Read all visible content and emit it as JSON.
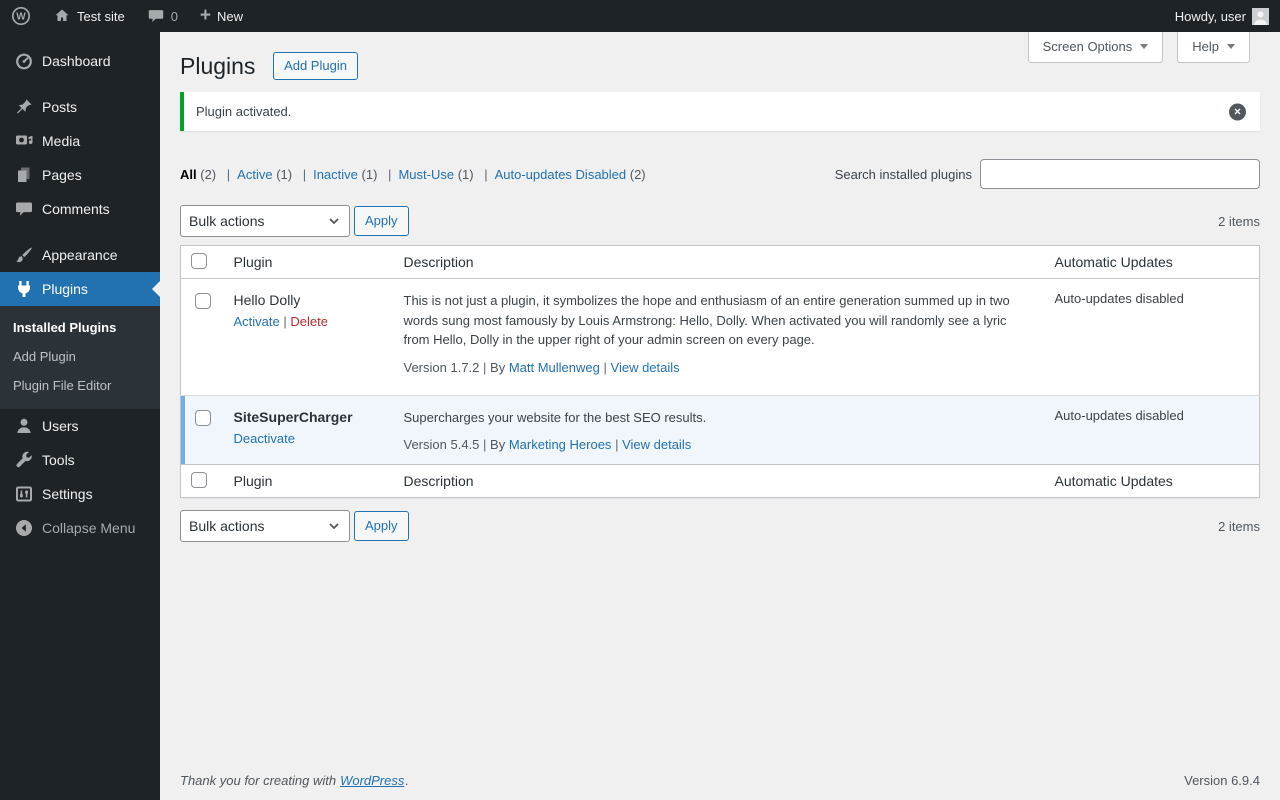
{
  "ui": {
    "separator": "|"
  },
  "admin_bar": {
    "site_name": "Test site",
    "comments_count": "0",
    "new_label": "New",
    "greeting": "Howdy, user"
  },
  "sidebar": {
    "items": [
      {
        "label": "Dashboard"
      },
      {
        "label": "Posts"
      },
      {
        "label": "Media"
      },
      {
        "label": "Pages"
      },
      {
        "label": "Comments"
      },
      {
        "label": "Appearance"
      },
      {
        "label": "Plugins"
      },
      {
        "label": "Users"
      },
      {
        "label": "Tools"
      },
      {
        "label": "Settings"
      },
      {
        "label": "Collapse Menu"
      }
    ],
    "plugins_submenu": [
      {
        "label": "Installed Plugins"
      },
      {
        "label": "Add Plugin"
      },
      {
        "label": "Plugin File Editor"
      }
    ]
  },
  "screen_meta": {
    "screen_options_label": "Screen Options",
    "help_label": "Help"
  },
  "page": {
    "title": "Plugins",
    "add_plugin_label": "Add Plugin"
  },
  "notice": {
    "message": "Plugin activated."
  },
  "filters": [
    {
      "label": "All",
      "count": "(2)"
    },
    {
      "label": "Active",
      "count": "(1)"
    },
    {
      "label": "Inactive",
      "count": "(1)"
    },
    {
      "label": "Must-Use",
      "count": "(1)"
    },
    {
      "label": "Auto-updates Disabled",
      "count": "(2)"
    }
  ],
  "search": {
    "label": "Search installed plugins",
    "value": ""
  },
  "tablenav": {
    "bulk_actions_label": "Bulk actions",
    "apply_label": "Apply",
    "items_count": "2 items"
  },
  "table": {
    "columns": {
      "plugin": "Plugin",
      "description": "Description",
      "auto_updates": "Automatic Updates"
    }
  },
  "plugins": [
    {
      "name": "Hello Dolly",
      "action1": "Activate",
      "action2": "Delete",
      "description": "This is not just a plugin, it symbolizes the hope and enthusiasm of an entire generation summed up in two words sung most famously by Louis Armstrong: Hello, Dolly. When activated you will randomly see a lyric from Hello, Dolly in the upper right of your admin screen on every page.",
      "version": "Version 1.7.2",
      "by_label": "By",
      "author": "Matt Mullenweg",
      "details_label": "View details",
      "auto_updates": "Auto-updates disabled"
    },
    {
      "name": "SiteSuperCharger",
      "action1": "Deactivate",
      "description": "Supercharges your website for the best SEO results.",
      "version": "Version 5.4.5",
      "by_label": "By",
      "author": "Marketing Heroes",
      "details_label": "View details",
      "auto_updates": "Auto-updates disabled"
    }
  ],
  "footer": {
    "thanks_text": "Thank you for creating with",
    "wordpress_label": "WordPress",
    "period": ".",
    "version": "Version 6.9.4"
  },
  "colors": {
    "accent_blue": "#2271b1",
    "notice_green": "#00a32a",
    "delete_red": "#b32d2e",
    "active_row_bg": "#f0f6fc",
    "active_row_border": "#72aee6",
    "admin_dark": "#1d2327",
    "submenu_bg": "#2c3338",
    "content_bg": "#f0f0f1"
  }
}
